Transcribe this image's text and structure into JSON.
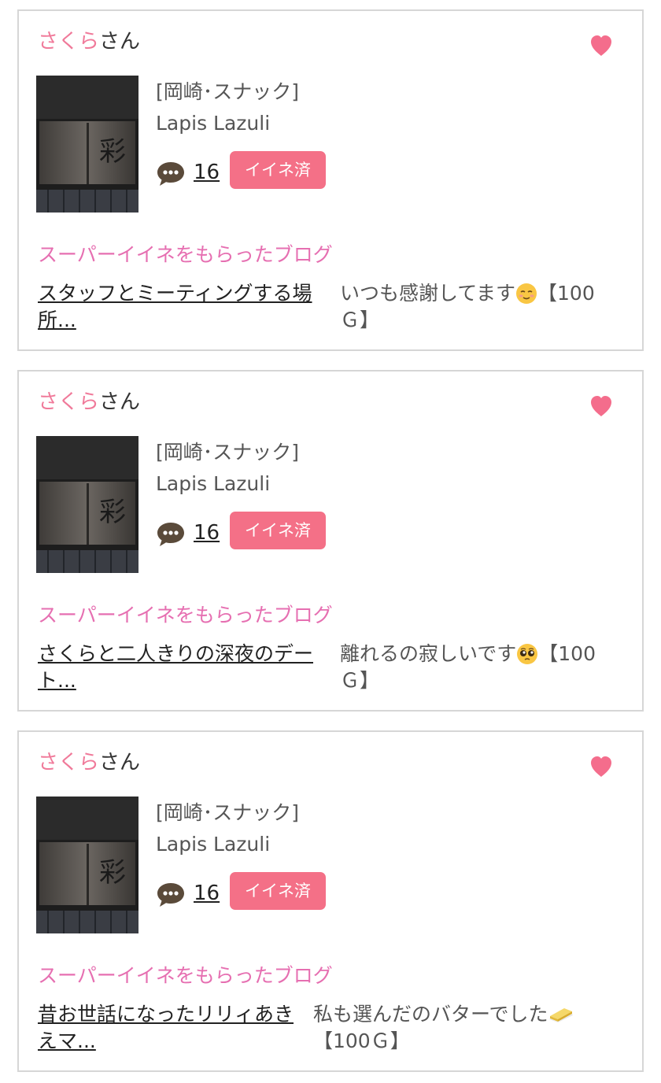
{
  "cards": [
    {
      "user_name": "さくら",
      "user_suffix": "さん",
      "shop_tag": "[岡崎･スナック]",
      "shop_title": "Lapis Lazuli",
      "comment_count": "16",
      "liked_label": "イイネ済",
      "section_title": "スーパーイイネをもらったブログ",
      "blog_title": "スタッフとミーティングする場所...",
      "blog_comment_text": "いつも感謝してます",
      "blog_comment_emoji": "relieved-face-emoji",
      "blog_comment_reward": "【100Ｇ】"
    },
    {
      "user_name": "さくら",
      "user_suffix": "さん",
      "shop_tag": "[岡崎･スナック]",
      "shop_title": "Lapis Lazuli",
      "comment_count": "16",
      "liked_label": "イイネ済",
      "section_title": "スーパーイイネをもらったブログ",
      "blog_title": "さくらと二人きりの深夜のデート...",
      "blog_comment_text": "離れるの寂しいです",
      "blog_comment_emoji": "pleading-face-emoji",
      "blog_comment_reward": "【100Ｇ】"
    },
    {
      "user_name": "さくら",
      "user_suffix": "さん",
      "shop_tag": "[岡崎･スナック]",
      "shop_title": "Lapis Lazuli",
      "comment_count": "16",
      "liked_label": "イイネ済",
      "section_title": "スーパーイイネをもらったブログ",
      "blog_title": "昔お世話になったリリィあきえマ...",
      "blog_comment_text": "私も選んだのバターでした",
      "blog_comment_emoji": "butter-emoji",
      "blog_comment_reward": "【100Ｇ】"
    }
  ],
  "colors": {
    "accent_pink": "#f07a9a",
    "button_pink": "#f47087",
    "section_pink": "#e66fb1",
    "border": "#d6d6d6"
  },
  "icons": {
    "heart": "heart-icon",
    "comment": "speech-bubble-icon"
  }
}
